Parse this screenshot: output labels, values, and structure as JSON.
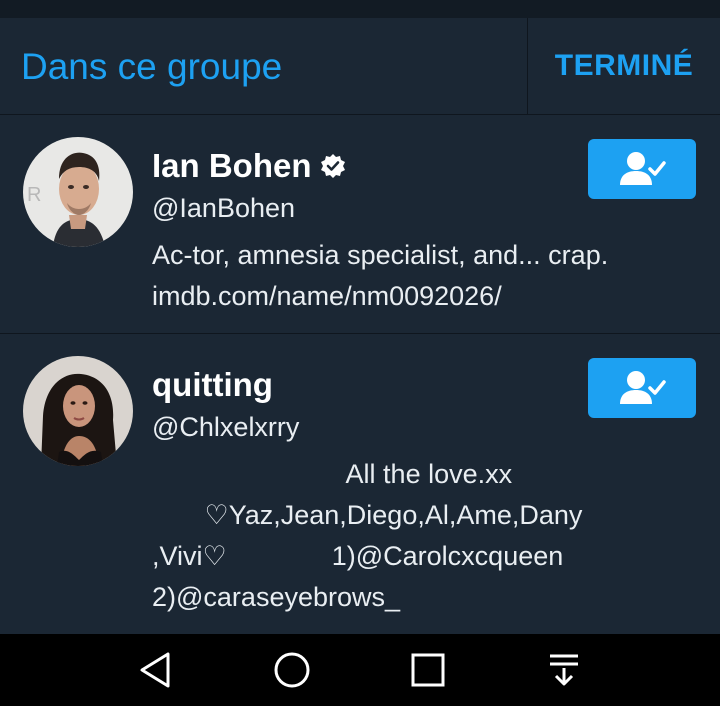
{
  "header": {
    "title": "Dans ce groupe",
    "done_label": "TERMINÉ"
  },
  "users": [
    {
      "name": "Ian Bohen",
      "verified": true,
      "handle": "@IanBohen",
      "bio_lines": [
        "Ac-tor, amnesia specialist, and... crap.",
        "imdb.com/name/nm0092026/"
      ]
    },
    {
      "name": "quitting",
      "verified": false,
      "handle": "@Chlxelxrry",
      "bio_lines": [
        "                          All the love.xx",
        "       ♡Yaz,Jean,Diego,Al,Ame,Dany",
        ",Vivi♡              1)@Carolcxcqueen",
        "2)@caraseyebrows_"
      ]
    }
  ],
  "icons": {
    "follow_button_icon": "following-person-check-icon",
    "verified_icon": "verified-badge-icon",
    "nav_back": "triangle-back-icon",
    "nav_home": "circle-home-icon",
    "nav_recents": "square-recents-icon",
    "nav_extra": "download-tray-icon"
  },
  "colors": {
    "accent": "#1da1f2",
    "background": "#1b2734",
    "text": "#ffffff"
  }
}
